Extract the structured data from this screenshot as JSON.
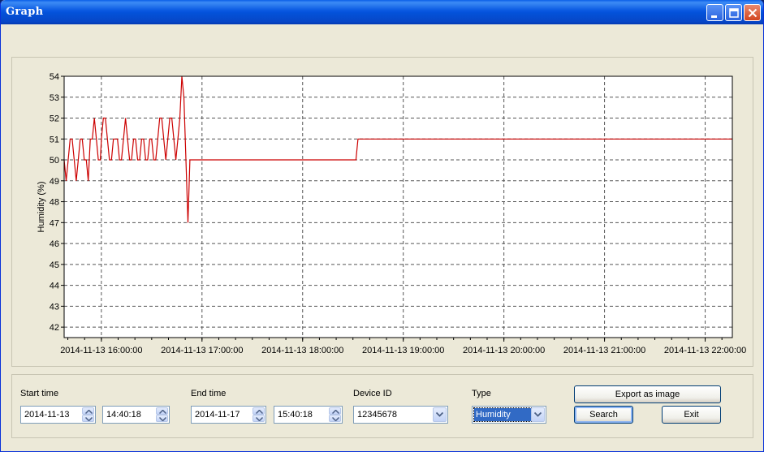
{
  "window": {
    "title": "Graph"
  },
  "chart_data": {
    "type": "line",
    "ylabel": "Humidity (%)",
    "xlabel": "",
    "ylim": [
      41.5,
      54
    ],
    "y_ticks": [
      42,
      43,
      44,
      45,
      46,
      47,
      48,
      49,
      50,
      51,
      52,
      53,
      54
    ],
    "x_tick_labels": [
      "2014-11-13 16:00:00",
      "2014-11-13 17:00:00",
      "2014-11-13 18:00:00",
      "2014-11-13 19:00:00",
      "2014-11-13 20:00:00",
      "2014-11-13 21:00:00",
      "2014-11-13 22:00:00"
    ],
    "x_range_hours": [
      15.63,
      22.27
    ],
    "grid": true,
    "line_color": "#cc0000",
    "series": [
      {
        "x": [
          15.63,
          15.65,
          15.67,
          15.69,
          15.71,
          15.73,
          15.75,
          15.77,
          15.79,
          15.81,
          15.83,
          15.85,
          15.87,
          15.89,
          15.91,
          15.93,
          15.95,
          15.97,
          15.99,
          16.0,
          16.02,
          16.04,
          16.06,
          16.08,
          16.1,
          16.12,
          16.14,
          16.16,
          16.18,
          16.2,
          16.22,
          16.24,
          16.26,
          16.28,
          16.3,
          16.32,
          16.34,
          16.36,
          16.38,
          16.4,
          16.42,
          16.44,
          16.46,
          16.48,
          16.5,
          16.52,
          16.54,
          16.56,
          16.58,
          16.6,
          16.62,
          16.64,
          16.66,
          16.68,
          16.7,
          16.72,
          16.74,
          16.76,
          16.78,
          16.8,
          16.82,
          16.84,
          16.86,
          16.88,
          16.9,
          16.92,
          16.94,
          16.96,
          16.98,
          17.0,
          17.02,
          17.04,
          17.06,
          17.08,
          17.1,
          17.12,
          17.14,
          17.16,
          17.18,
          17.2,
          17.23,
          17.25,
          18.53,
          18.55,
          22.27
        ],
        "y": [
          50,
          49,
          50,
          51,
          51,
          50,
          49,
          50,
          51,
          51,
          50,
          50,
          49,
          51,
          51,
          52,
          51,
          50,
          50,
          51,
          52,
          52,
          51,
          50,
          50,
          51,
          51,
          51,
          50,
          50,
          51,
          52,
          51,
          50,
          50,
          51,
          51,
          50,
          50,
          51,
          51,
          50,
          50,
          51,
          51,
          50,
          50,
          51,
          52,
          52,
          51,
          50,
          51,
          52,
          52,
          51,
          50,
          51,
          52,
          54,
          53,
          50,
          47,
          50,
          50,
          50,
          50,
          50,
          50,
          50,
          50,
          50,
          50,
          50,
          50,
          50,
          50,
          50,
          50,
          50,
          50,
          50,
          50,
          51,
          51
        ]
      }
    ]
  },
  "controls": {
    "start_time_label": "Start time",
    "start_date": "2014-11-13",
    "start_time": "14:40:18",
    "end_time_label": "End time",
    "end_date": "2014-11-17",
    "end_time": "15:40:18",
    "device_id_label": "Device ID",
    "device_id": "12345678",
    "type_label": "Type",
    "type_value": "Humidity",
    "export_label": "Export as image",
    "search_label": "Search",
    "exit_label": "Exit"
  },
  "icons": {
    "minimize": "minimize-icon",
    "maximize": "maximize-icon",
    "close": "close-icon",
    "spin_up": "arrow-up-icon",
    "spin_down": "arrow-down-icon",
    "dropdown": "chevron-down-icon"
  }
}
